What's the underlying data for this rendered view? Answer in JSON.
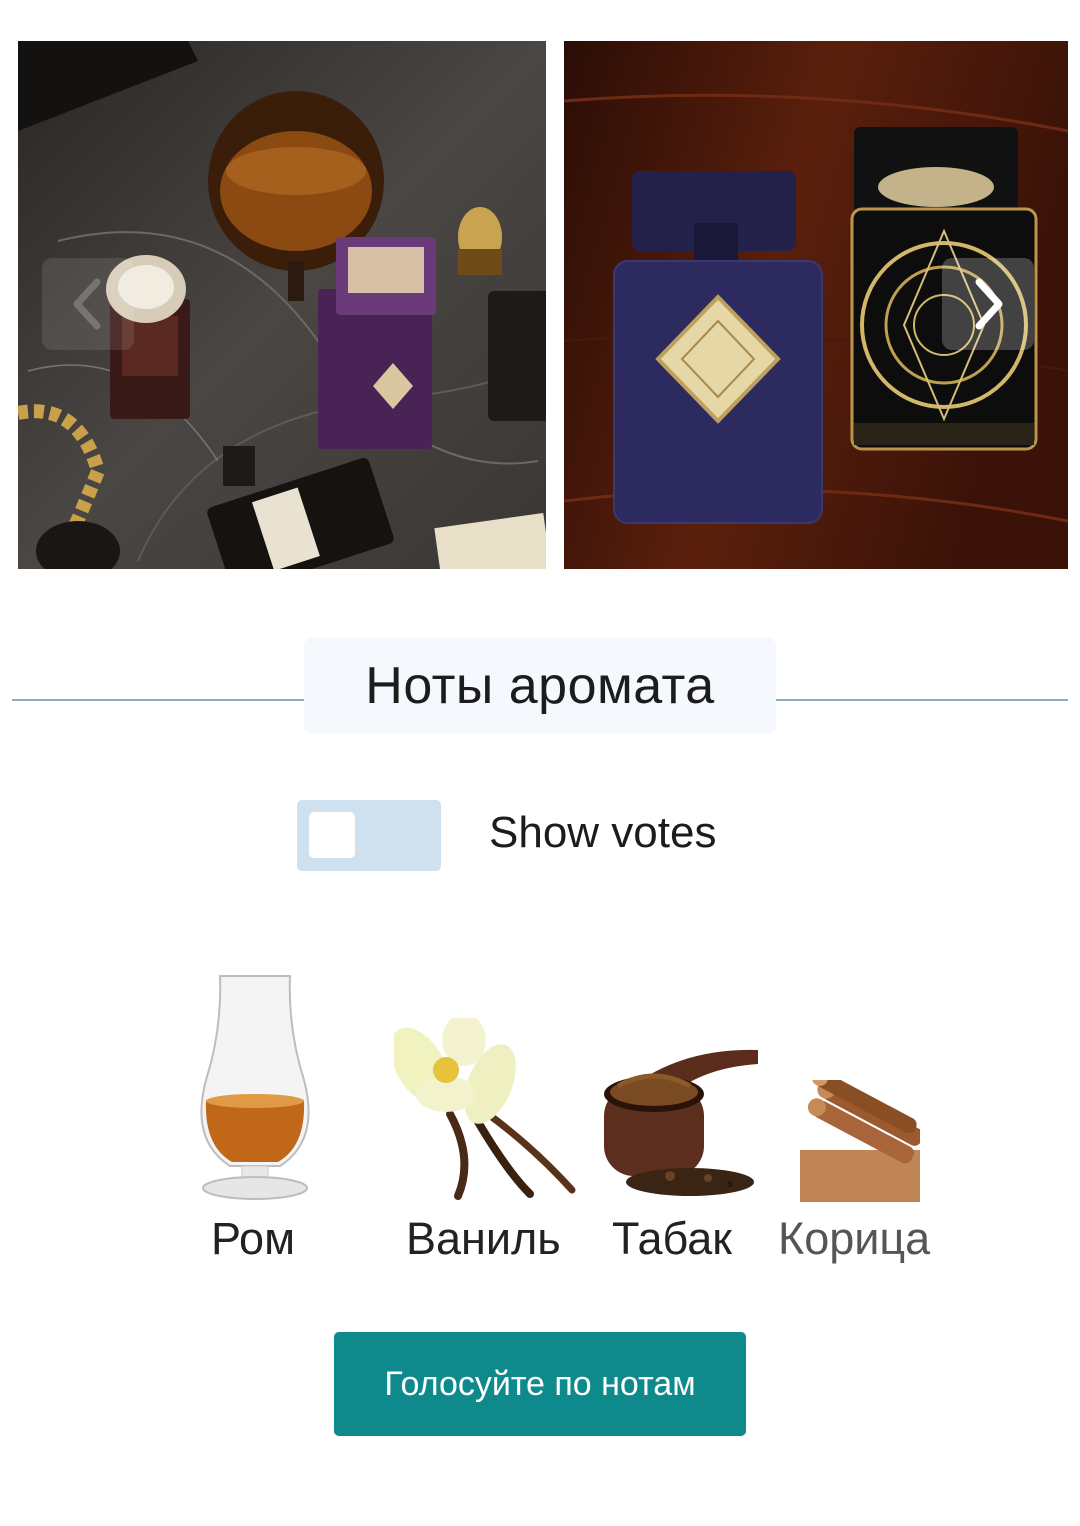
{
  "gallery": {
    "photos": [
      {
        "name": "perfume-still-life-marble"
      },
      {
        "name": "perfume-bottles-wood-table"
      }
    ],
    "prev_icon": "chevron-left-icon",
    "next_icon": "chevron-right-icon"
  },
  "section": {
    "title": "Ноты аромата"
  },
  "votes_toggle": {
    "label": "Show votes",
    "checked": false
  },
  "notes": [
    {
      "label": "Ром",
      "icon": "rum-glass-icon"
    },
    {
      "label": "Ваниль",
      "icon": "vanilla-flower-icon"
    },
    {
      "label": "Табак",
      "icon": "tobacco-pipe-icon"
    },
    {
      "label": "Корица",
      "icon": "cinnamon-sticks-icon"
    }
  ],
  "vote_button": {
    "label": "Голосуйте по нотам"
  },
  "colors": {
    "accent": "#0e8a8c",
    "rule": "#8eaabb",
    "toggle_track": "#cfe0ee",
    "title_bg": "#f5f8fc"
  }
}
